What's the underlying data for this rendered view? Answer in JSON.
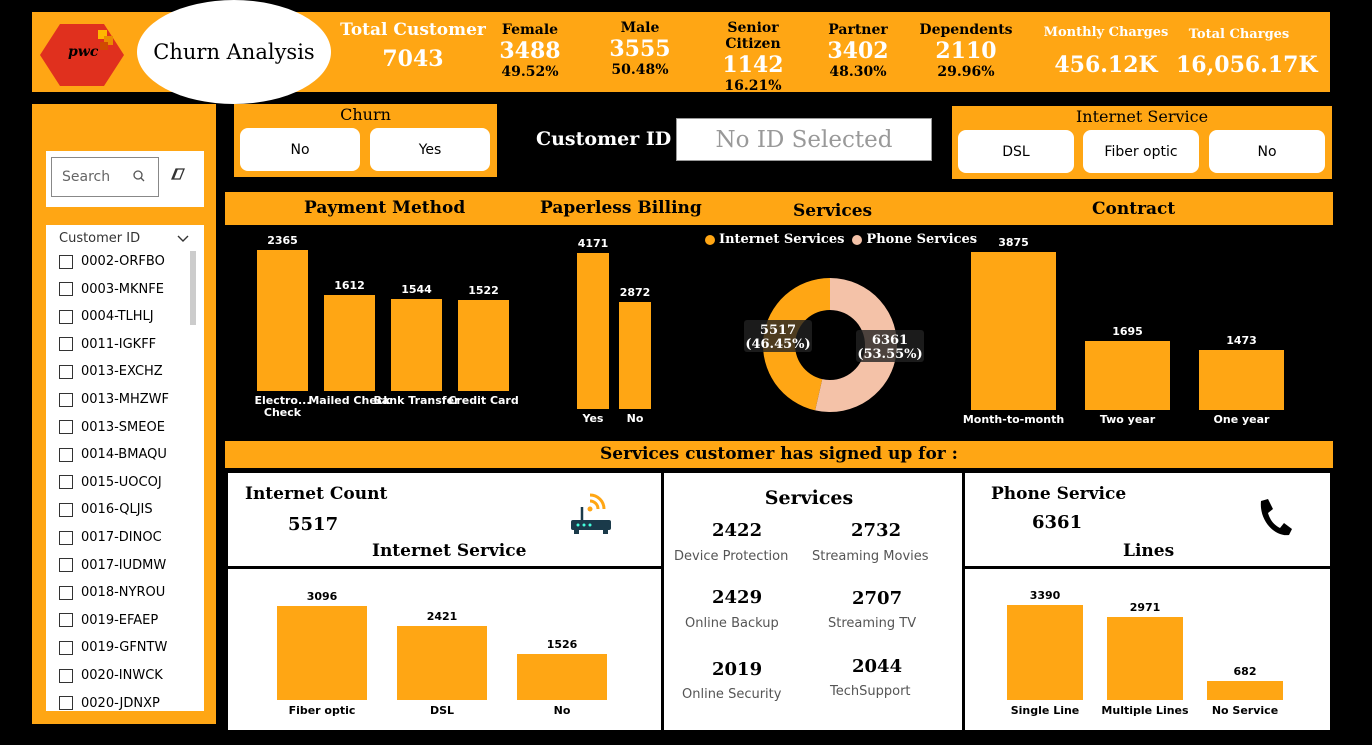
{
  "header": {
    "logo_text": "pwc",
    "title": "Churn Analysis",
    "kpis": [
      {
        "label": "Total Customer",
        "value": "7043",
        "pct": ""
      },
      {
        "label": "Female",
        "value": "3488",
        "pct": "49.52%"
      },
      {
        "label": "Male",
        "value": "3555",
        "pct": "50.48%"
      },
      {
        "label": "Senior Citizen",
        "value": "1142",
        "pct": "16.21%"
      },
      {
        "label": "Partner",
        "value": "3402",
        "pct": "48.30%"
      },
      {
        "label": "Dependents",
        "value": "2110",
        "pct": "29.96%"
      },
      {
        "label": "Monthly Charges",
        "value": "456.12K",
        "pct": ""
      },
      {
        "label": "Total Charges",
        "value": "16,056.17K",
        "pct": ""
      }
    ]
  },
  "sidebar": {
    "search_placeholder": "Search",
    "list_header": "Customer ID",
    "customers": [
      "0002-ORFBO",
      "0003-MKNFE",
      "0004-TLHLJ",
      "0011-IGKFF",
      "0013-EXCHZ",
      "0013-MHZWF",
      "0013-SMEOE",
      "0014-BMAQU",
      "0015-UOCOJ",
      "0016-QLJIS",
      "0017-DINOC",
      "0017-IUDMW",
      "0018-NYROU",
      "0019-EFAEP",
      "0019-GFNTW",
      "0020-INWCK",
      "0020-JDNXP"
    ]
  },
  "churn_slicer": {
    "title": "Churn",
    "options": [
      "No",
      "Yes"
    ]
  },
  "customer_id": {
    "label": "Customer ID :",
    "value": "No ID Selected"
  },
  "internet_slicer": {
    "title": "Internet Service",
    "options": [
      "DSL",
      "Fiber optic",
      "No"
    ]
  },
  "section_titles": {
    "payment": "Payment Method",
    "paperless": "Paperless Billing",
    "services": "Services",
    "contract": "Contract",
    "signed_up": "Services customer has signed up for :"
  },
  "colors": {
    "accent": "#FFA614",
    "phone": "#F4C2A8",
    "black": "#000000"
  },
  "chart_data": [
    {
      "type": "bar",
      "title": "Payment Method",
      "categories": [
        "Electro... Check",
        "Mailed Check",
        "Bank Transfer",
        "Credit Card"
      ],
      "values": [
        2365,
        1612,
        1544,
        1522
      ]
    },
    {
      "type": "bar",
      "title": "Paperless Billing",
      "categories": [
        "Yes",
        "No"
      ],
      "values": [
        4171,
        2872
      ]
    },
    {
      "type": "pie",
      "title": "Services",
      "categories": [
        "Internet Services",
        "Phone Services"
      ],
      "values": [
        5517,
        6361
      ],
      "labels": [
        "5517 (46.45%)",
        "6361 (53.55%)"
      ]
    },
    {
      "type": "bar",
      "title": "Contract",
      "categories": [
        "Month-to-month",
        "Two year",
        "One year"
      ],
      "values": [
        3875,
        1695,
        1473
      ]
    },
    {
      "type": "bar",
      "title": "Internet Service",
      "categories": [
        "Fiber optic",
        "DSL",
        "No"
      ],
      "values": [
        3096,
        2421,
        1526
      ]
    },
    {
      "type": "bar",
      "title": "Lines",
      "categories": [
        "Single Line",
        "Multiple Lines",
        "No Service"
      ],
      "values": [
        3390,
        2971,
        682
      ]
    }
  ],
  "internet_card": {
    "title": "Internet Count",
    "value": "5517",
    "subtitle": "Internet Service",
    "icon": "router-icon"
  },
  "services_card": {
    "title": "Services",
    "items": [
      {
        "value": "2422",
        "label": "Device Protection"
      },
      {
        "value": "2732",
        "label": "Streaming Movies"
      },
      {
        "value": "2429",
        "label": "Online Backup"
      },
      {
        "value": "2707",
        "label": "Streaming TV"
      },
      {
        "value": "2019",
        "label": "Online Security"
      },
      {
        "value": "2044",
        "label": "TechSupport"
      }
    ]
  },
  "phone_card": {
    "title": "Phone Service",
    "value": "6361",
    "subtitle": "Lines",
    "icon": "phone-icon"
  }
}
